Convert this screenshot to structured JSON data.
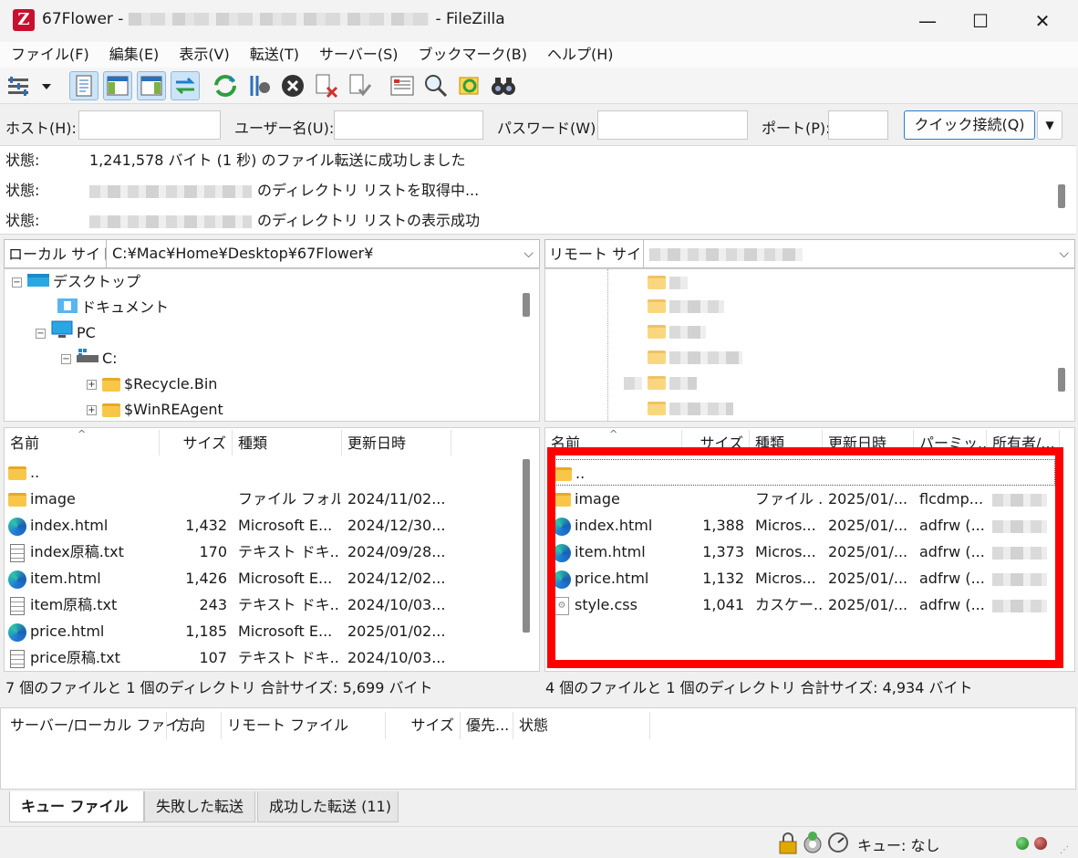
{
  "window": {
    "app_letter": "Z",
    "title_prefix": "67Flower -",
    "title_suffix": "- FileZilla",
    "minimize": "—",
    "maximize": "☐",
    "close": "✕"
  },
  "menu": [
    "ファイル(F)",
    "編集(E)",
    "表示(V)",
    "転送(T)",
    "サーバー(S)",
    "ブックマーク(B)",
    "ヘルプ(H)"
  ],
  "quickconnect": {
    "host_label": "ホスト(H):",
    "user_label": "ユーザー名(U):",
    "password_label": "パスワード(W):",
    "port_label": "ポート(P):",
    "host_value": "",
    "user_value": "",
    "password_value": "",
    "port_value": "",
    "connect_button": "クイック接続(Q)",
    "dropdown": "▼"
  },
  "log": [
    {
      "label": "状態:",
      "text": "1,241,578 バイト (1 秒) のファイル転送に成功しました"
    },
    {
      "label": "状態:",
      "text": "のディレクトリ リストを取得中..."
    },
    {
      "label": "状態:",
      "text": "のディレクトリ リストの表示成功"
    }
  ],
  "local": {
    "site_label": "ローカル サイト:",
    "path": "C:¥Mac¥Home¥Desktop¥67Flower¥",
    "tree": [
      {
        "label": "デスクトップ",
        "expander": "−"
      },
      {
        "label": "ドキュメント",
        "expander": ""
      },
      {
        "label": "PC",
        "expander": "−"
      },
      {
        "label": "C:",
        "expander": "−"
      },
      {
        "label": "$Recycle.Bin",
        "expander": "+"
      },
      {
        "label": "$WinREAgent",
        "expander": "+"
      }
    ],
    "headers": [
      "名前",
      "サイズ",
      "種類",
      "更新日時"
    ],
    "files": [
      {
        "name": "..",
        "size": "",
        "type": "",
        "date": "",
        "icon": "folder-icon"
      },
      {
        "name": "image",
        "size": "",
        "type": "ファイル フォル...",
        "date": "2024/11/02...",
        "icon": "folder-icon"
      },
      {
        "name": "index.html",
        "size": "1,432",
        "type": "Microsoft E...",
        "date": "2024/12/30...",
        "icon": "edge-icon"
      },
      {
        "name": "index原稿.txt",
        "size": "170",
        "type": "テキスト ドキ...",
        "date": "2024/09/28...",
        "icon": "text-file-icon"
      },
      {
        "name": "item.html",
        "size": "1,426",
        "type": "Microsoft E...",
        "date": "2024/12/02...",
        "icon": "edge-icon"
      },
      {
        "name": "item原稿.txt",
        "size": "243",
        "type": "テキスト ドキ...",
        "date": "2024/10/03...",
        "icon": "text-file-icon"
      },
      {
        "name": "price.html",
        "size": "1,185",
        "type": "Microsoft E...",
        "date": "2025/01/02...",
        "icon": "edge-icon"
      },
      {
        "name": "price原稿.txt",
        "size": "107",
        "type": "テキスト ドキ...",
        "date": "2024/10/03...",
        "icon": "text-file-icon"
      }
    ],
    "status": "7 個のファイルと 1 個のディレクトリ 合計サイズ: 5,699 バイト"
  },
  "remote": {
    "site_label": "リモート サイト:",
    "path": "",
    "headers": [
      "名前",
      "サイズ",
      "種類",
      "更新日時",
      "パーミッ...",
      "所有者/..."
    ],
    "files": [
      {
        "name": "..",
        "size": "",
        "type": "",
        "date": "",
        "perm": "",
        "icon": "folder-icon"
      },
      {
        "name": "image",
        "size": "",
        "type": "ファイル ...",
        "date": "2025/01/...",
        "perm": "flcdmp...",
        "icon": "folder-icon"
      },
      {
        "name": "index.html",
        "size": "1,388",
        "type": "Micros...",
        "date": "2025/01/...",
        "perm": "adfrw (...",
        "icon": "edge-icon"
      },
      {
        "name": "item.html",
        "size": "1,373",
        "type": "Micros...",
        "date": "2025/01/...",
        "perm": "adfrw (...",
        "icon": "edge-icon"
      },
      {
        "name": "price.html",
        "size": "1,132",
        "type": "Micros...",
        "date": "2025/01/...",
        "perm": "adfrw (...",
        "icon": "edge-icon"
      },
      {
        "name": "style.css",
        "size": "1,041",
        "type": "カスケー...",
        "date": "2025/01/...",
        "perm": "adfrw (...",
        "icon": "css-file-icon"
      }
    ],
    "status": "4 個のファイルと 1 個のディレクトリ 合計サイズ: 4,934 バイト"
  },
  "queue": {
    "headers": [
      "サーバー/ローカル ファイ...",
      "方向",
      "リモート ファイル",
      "サイズ",
      "優先...",
      "状態"
    ],
    "tabs": [
      "キュー ファイル",
      "失敗した転送",
      "成功した転送 (11)"
    ]
  },
  "statusbar": {
    "queue_text": "キュー: なし"
  },
  "colors": {
    "highlight_box": "#ff0000",
    "active_tool": "#cce4f7"
  }
}
